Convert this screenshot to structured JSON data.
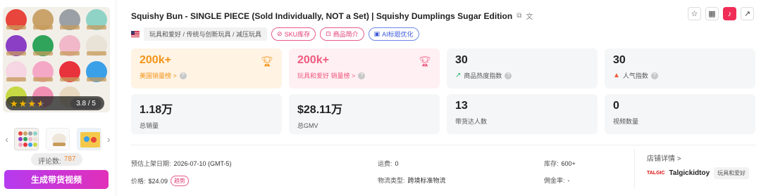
{
  "product": {
    "title": "Squishy Bun - SINGLE PIECE (Sold Individually, NOT a Set) | Squishy Dumplings Sugar Edition",
    "rating": "3.8 / 5",
    "review_label": "评论数:",
    "review_count": "787",
    "cta_label": "生成带货视频"
  },
  "tags": {
    "category": "玩具和爱好 / 传统与创新玩具 / 减压玩具",
    "sku": "SKU库存",
    "intro": "商品简介",
    "ai": "AI标题优化"
  },
  "metrics": [
    {
      "value": "200k+",
      "label": "美国销量榜 >",
      "style": "orange"
    },
    {
      "value": "200k+",
      "label": "玩具和爱好 销量榜 >",
      "style": "pink"
    },
    {
      "value": "30",
      "label": "商品热度指数",
      "style": "grey"
    },
    {
      "value": "30",
      "label": "人气指数",
      "style": "grey"
    },
    {
      "value": "1.18万",
      "label": "总销量",
      "style": "grey"
    },
    {
      "value": "$28.11万",
      "label": "总GMV",
      "style": "grey"
    },
    {
      "value": "13",
      "label": "带货达人数",
      "style": "grey"
    },
    {
      "value": "0",
      "label": "视频数量",
      "style": "grey"
    }
  ],
  "info": {
    "launch_key": "预估上架日期:",
    "launch_val": "2026-07-10 (GMT-5)",
    "shipping_key": "运费:",
    "shipping_val": "0",
    "stock_key": "库存:",
    "stock_val": "600+",
    "price_key": "价格:",
    "price_val": "$24.09",
    "trend_label": "趋势",
    "logistics_key": "物流类型:",
    "logistics_val": "跨境标准物流",
    "commission_key": "佣金率:",
    "commission_val": "-"
  },
  "shop": {
    "link_label": "店铺详情 >",
    "logo_text": "TALGIC",
    "name": "Talgickidtoy",
    "category": "玩具和爱好"
  },
  "colors": {
    "accent_orange": "#f39418",
    "accent_pink": "#f0597f",
    "cta_start": "#b53bef",
    "cta_end": "#e12fb9"
  },
  "icons": [
    "copy-icon",
    "translate-icon",
    "star-outline-icon",
    "grid-icon",
    "tiktok-icon",
    "external-link-icon",
    "trophy-icon",
    "trend-up-icon",
    "fire-icon",
    "help-icon"
  ]
}
